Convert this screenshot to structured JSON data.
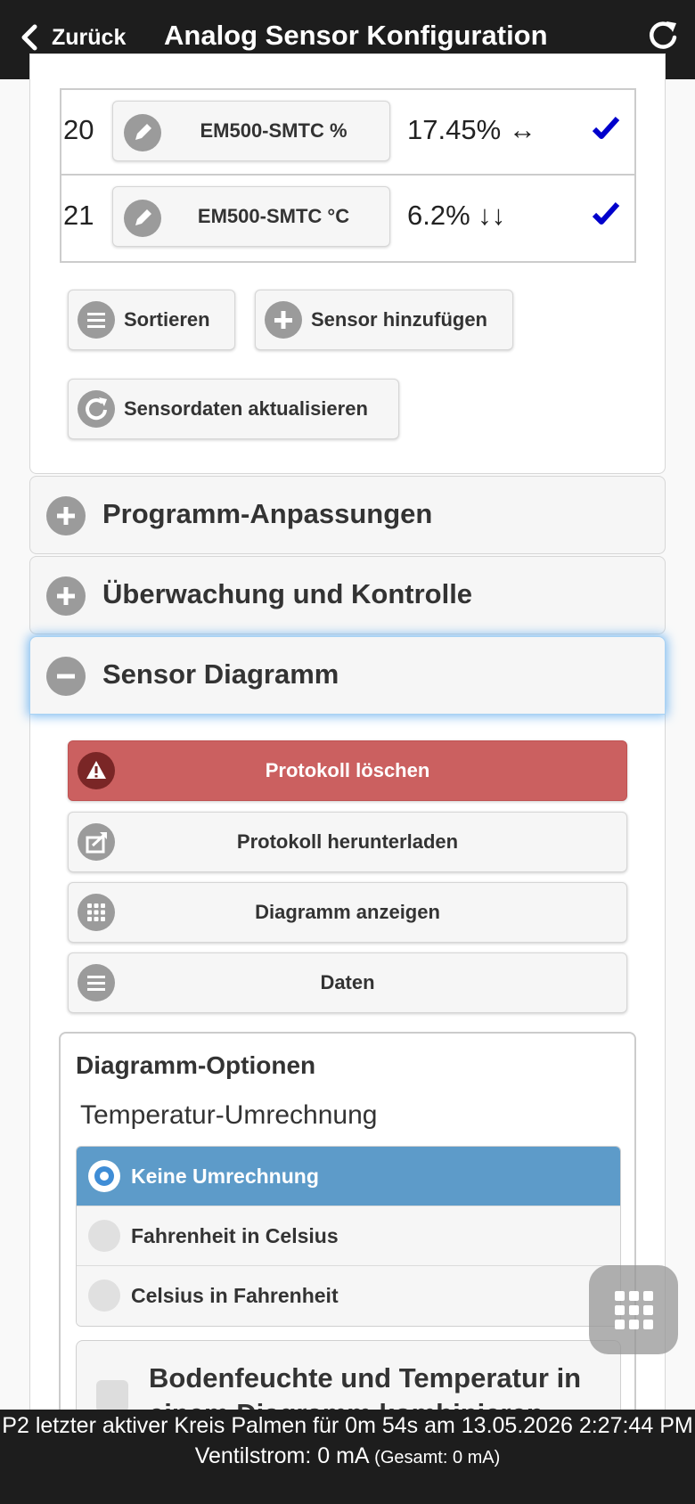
{
  "header": {
    "back_label": "Zurück",
    "title": "Analog Sensor Konfiguration"
  },
  "sensors": [
    {
      "num": "20",
      "name": "EM500-SMTC %",
      "value": "17.45% ↔"
    },
    {
      "num": "21",
      "name": "EM500-SMTC °C",
      "value": "6.2% ↓↓"
    }
  ],
  "sensor_actions": {
    "sort": "Sortieren",
    "add": "Sensor hinzufügen",
    "refresh": "Sensordaten aktualisieren"
  },
  "sections": {
    "program": "Programm-Anpassungen",
    "monitoring": "Überwachung und Kontrolle",
    "diagram": "Sensor Diagramm"
  },
  "diagram_actions": {
    "clear_log": "Protokoll löschen",
    "download_log": "Protokoll herunterladen",
    "show_chart": "Diagramm anzeigen",
    "data": "Daten"
  },
  "options": {
    "title": "Diagramm-Optionen",
    "temp_label": "Temperatur-Umrechnung",
    "radios": [
      "Keine Umrechnung",
      "Fahrenheit in Celsius",
      "Celsius in Fahrenheit"
    ],
    "combine_label": "Bodenfeuchte und Temperatur in einem Diagramm kombinieren"
  },
  "footer": {
    "line1": "P2 letzter aktiver Kreis Palmen für 0m 54s am 13.05.2026 2:27:44 PM",
    "line2": "Ventilstrom: 0 mA",
    "line2_small": "(Gesamt: 0 mA)"
  },
  "colors": {
    "header_bg": "#1d1d1d",
    "danger": "#cb6060",
    "selected_radio": "#5d9bc9",
    "checkmark": "#0000cc"
  }
}
